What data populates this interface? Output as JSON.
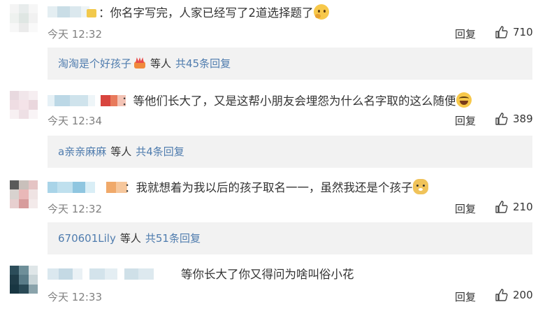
{
  "comments": [
    {
      "text": "：你名字写完，人家已经写了2道选择题了",
      "emoji": "thinking-face-icon",
      "time": "今天 12:32",
      "reply_label": "回复",
      "likes": "710",
      "sub": {
        "user": "淘淘是个好孩子",
        "etc": "等人",
        "total": "共45条回复"
      }
    },
    {
      "text": "：等他们长大了，又是这帮小朋友会埋怨为什么名字取的这么随便",
      "emoji": "laughing-tears-icon",
      "time": "今天 12:34",
      "reply_label": "回复",
      "likes": "389",
      "sub": {
        "user": "a亲亲麻麻",
        "etc": "等人",
        "total": "共4条回复"
      }
    },
    {
      "text": "：我就想着为我以后的孩子取名一一，虽然我还是个孩子",
      "emoji": "doge-icon",
      "time": "今天 12:32",
      "reply_label": "回复",
      "likes": "210",
      "sub": {
        "user": "670601Lily",
        "etc": "等人",
        "total": "共51条回复"
      }
    },
    {
      "text": "等你长大了你又得问为啥叫俗小花",
      "time": "今天 12:33",
      "reply_label": "回复",
      "likes": "200"
    }
  ]
}
